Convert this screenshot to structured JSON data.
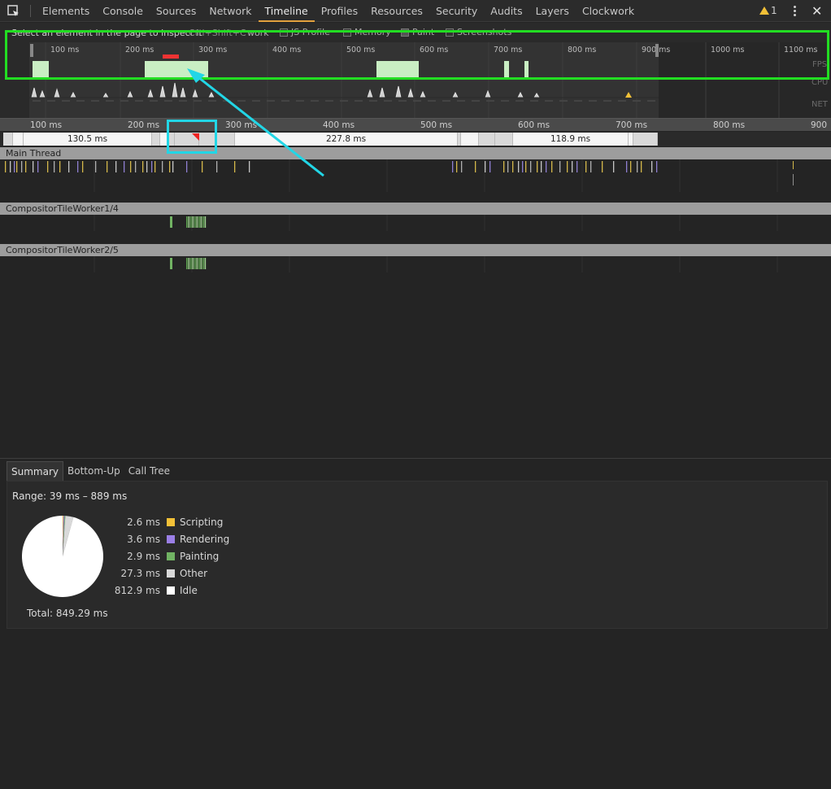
{
  "tabs": [
    {
      "label": "Elements"
    },
    {
      "label": "Console"
    },
    {
      "label": "Sources"
    },
    {
      "label": "Network"
    },
    {
      "label": "Timeline",
      "active": true
    },
    {
      "label": "Profiles"
    },
    {
      "label": "Resources"
    },
    {
      "label": "Security"
    },
    {
      "label": "Audits"
    },
    {
      "label": "Layers"
    },
    {
      "label": "Clockwork"
    }
  ],
  "warnings": {
    "count": "1",
    "icon": "warning-icon"
  },
  "overview": {
    "hint": "Select an element in the page to inspect it",
    "hint_key": "Ctrl+Shift+C",
    "hint_tail": "work",
    "options": [
      {
        "label": "JS Profile",
        "checked": false
      },
      {
        "label": "Memory",
        "checked": false
      },
      {
        "label": "Paint",
        "checked": true
      },
      {
        "label": "Screenshots",
        "checked": false
      }
    ],
    "ticks": [
      "100 ms",
      "200 ms",
      "300 ms",
      "400 ms",
      "500 ms",
      "600 ms",
      "700 ms",
      "800 ms",
      "900 ms",
      "1000 ms",
      "1100 ms"
    ],
    "rows": {
      "fps": "FPS",
      "cpu": "CPU",
      "net": "NET"
    }
  },
  "flame": {
    "ticks": [
      "100 ms",
      "200 ms",
      "300 ms",
      "400 ms",
      "500 ms",
      "600 ms",
      "700 ms",
      "800 ms",
      "900 ms"
    ],
    "frames": [
      "130.5 ms",
      "227.8 ms",
      "118.9 ms"
    ]
  },
  "threads": {
    "main": "Main Thread",
    "worker1": "CompositorTileWorker1/4",
    "worker2": "CompositorTileWorker2/5"
  },
  "details": {
    "tabs": [
      {
        "label": "Summary",
        "active": true
      },
      {
        "label": "Bottom-Up"
      },
      {
        "label": "Call Tree"
      }
    ],
    "range": "Range: 39 ms – 889 ms",
    "total": "Total: 849.29 ms",
    "legend": [
      {
        "value": "2.6 ms",
        "label": "Scripting",
        "color": "#f2c037",
        "ms": 2.6
      },
      {
        "value": "3.6 ms",
        "label": "Rendering",
        "color": "#9b7fe6",
        "ms": 3.6
      },
      {
        "value": "2.9 ms",
        "label": "Painting",
        "color": "#71b363",
        "ms": 2.9
      },
      {
        "value": "27.3 ms",
        "label": "Other",
        "color": "#d9d9d9",
        "ms": 27.3
      },
      {
        "value": "812.9 ms",
        "label": "Idle",
        "color": "#ffffff",
        "ms": 812.9
      }
    ]
  },
  "colors": {
    "accent_tab": "#e3a13d",
    "highlight_green": "#22dd22",
    "highlight_cyan": "#22d6e6"
  }
}
